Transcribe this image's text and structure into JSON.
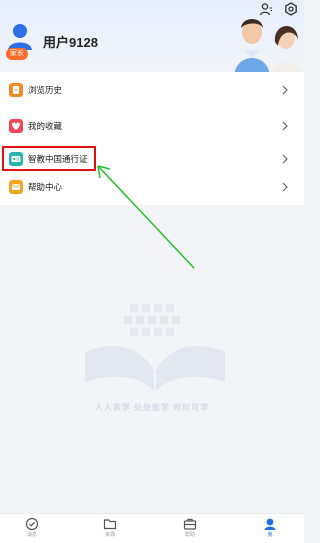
{
  "header": {
    "username": "用户9128",
    "role_badge": "家长"
  },
  "menu_group_1": [
    {
      "label": "浏览历史",
      "icon": "history-icon",
      "color": "#f08a24"
    },
    {
      "label": "我的收藏",
      "icon": "heart-icon",
      "color": "#f04a5a"
    }
  ],
  "menu_group_2": [
    {
      "label": "智教中国通行证",
      "icon": "id-card-icon",
      "color": "#27b3b0"
    },
    {
      "label": "帮助中心",
      "icon": "help-mail-icon",
      "color": "#f5a623"
    }
  ],
  "slogan": "人人皆学  处处能学  时时可学",
  "tabs": [
    {
      "label": "消息",
      "icon": "message-check-icon",
      "active": false
    },
    {
      "label": "资源",
      "icon": "folder-icon",
      "active": false
    },
    {
      "label": "帮助",
      "icon": "briefcase-icon",
      "active": false
    },
    {
      "label": "我",
      "icon": "user-profile-icon",
      "active": true
    }
  ],
  "colors": {
    "accent": "#1f6fe5",
    "highlight_box": "#e21212",
    "arrow": "#22c02a",
    "badge": "#ff6a2b"
  }
}
